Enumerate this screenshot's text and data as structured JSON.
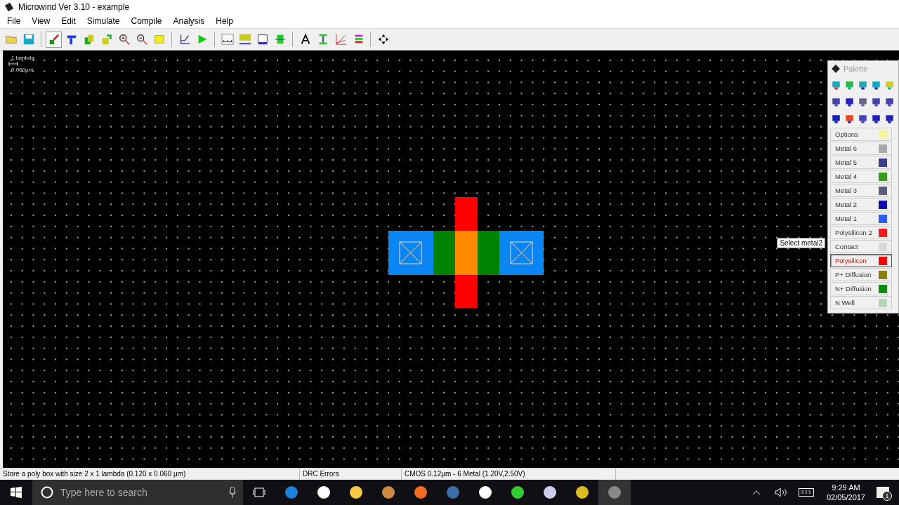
{
  "window": {
    "title": "Microwind Ver 3.10 - example"
  },
  "menu": [
    "File",
    "View",
    "Edit",
    "Simulate",
    "Compile",
    "Analysis",
    "Help"
  ],
  "toolbar": {
    "groups": [
      [
        {
          "selected": false
        },
        {
          "selected": false
        }
      ],
      [
        {
          "selected": true
        },
        {
          "selected": false
        },
        {
          "selected": false
        },
        {
          "selected": false
        },
        {
          "selected": false
        },
        {
          "selected": false
        },
        {
          "selected": false
        }
      ],
      [
        {
          "selected": false
        },
        {
          "selected": false
        }
      ],
      [
        {
          "selected": false
        },
        {
          "selected": false
        },
        {
          "selected": false
        },
        {
          "selected": false
        }
      ],
      [
        {
          "selected": false
        },
        {
          "selected": false
        },
        {
          "selected": false
        },
        {
          "selected": false
        }
      ],
      [
        {
          "selected": false
        }
      ]
    ]
  },
  "scale": {
    "label": "1 lambda",
    "size": "0.060µm"
  },
  "palette": {
    "title": "Palette",
    "tooltip": "Select metal2",
    "layers": [
      {
        "label": "Options",
        "color": "#f4f49a",
        "selected": false
      },
      {
        "label": "Metal 6",
        "color": "#a8a8a8",
        "selected": false
      },
      {
        "label": "Metal 5",
        "color": "#3c3c8c",
        "selected": false
      },
      {
        "label": "Metal 4",
        "color": "#3c9c1c",
        "selected": false
      },
      {
        "label": "Metal 3",
        "color": "#5c5c7c",
        "selected": false
      },
      {
        "label": "Metal 2",
        "color": "#0c0ca8",
        "selected": false
      },
      {
        "label": "Metal 1",
        "color": "#2c5cf4",
        "selected": false
      },
      {
        "label": "Polysilicon 2",
        "color": "#f41c1c",
        "selected": false
      },
      {
        "label": "Contact",
        "color": "#d8d8d8",
        "selected": false
      },
      {
        "label": "Polysilicon",
        "color": "#fc0000",
        "selected": true
      },
      {
        "label": "P+ Diffusion",
        "color": "#8c7c0c",
        "selected": false
      },
      {
        "label": "N+ Diffusion",
        "color": "#0c8c0c",
        "selected": false
      },
      {
        "label": "N Well",
        "color": "#b8d4b8",
        "selected": false
      }
    ]
  },
  "status_bar": [
    "Store a poly box with size 2 x 1 lambda (0.120 x 0.060 µm)",
    "DRC Errors",
    "CMOS 0.12µm - 6 Metal (1.20V,2.50V)"
  ],
  "taskbar": {
    "search_placeholder": "Type here to search",
    "time": "9:29 AM",
    "date": "02/05/2017",
    "notifications": "1"
  }
}
